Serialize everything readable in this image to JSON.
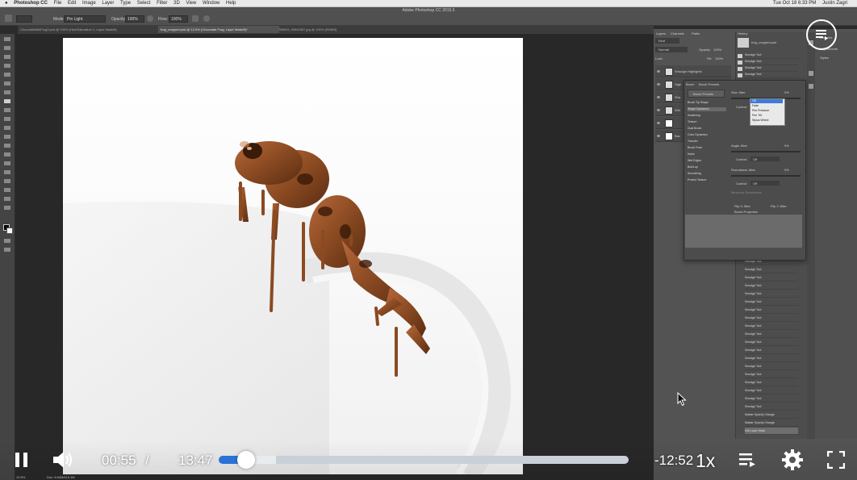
{
  "menubar": {
    "apple": "",
    "app_name": "Photoshop CC",
    "items": [
      "File",
      "Edit",
      "Image",
      "Layer",
      "Type",
      "Select",
      "Filter",
      "3D",
      "View",
      "Window",
      "Help"
    ],
    "clock": "Tue Oct 18 6:33 PM",
    "user": "Justin Zagri"
  },
  "window_title": "Adobe Photoshop CC 2015.5",
  "options_bar": {
    "mode_label": "Mode:",
    "mode_value": "Pin Light",
    "opacity_label": "Opacity:",
    "opacity_value": "100%",
    "flow_label": "Flow:",
    "flow_value": "100%"
  },
  "doc_tabs": [
    {
      "label": "ChocolateMilkFrog3.psd @ 100% (Hue/Saturation 1, Layer Mask/8)",
      "active": false
    },
    {
      "label": "frog_cropped.psd @ 12.5% (Chocolate Frog, Layer Mask/8)*",
      "active": true
    },
    {
      "label": "768615_93504357.jpg @ 100% (RGB/8)",
      "active": false
    }
  ],
  "panels": {
    "layers_tabs": [
      "Layers",
      "Channels",
      "Paths"
    ],
    "kind_label": "Kind",
    "blend_label": "Normal",
    "opacity_label": "Opacity:",
    "opacity_value": "100%",
    "lock_label": "Lock:",
    "fill_label": "Fill:",
    "fill_value": "100%",
    "layers": [
      {
        "name": "Smudge Highlights"
      },
      {
        "name": "High"
      },
      {
        "name": "Sha"
      },
      {
        "name": "Whi"
      },
      {
        "name": ""
      },
      {
        "name": "Bac"
      }
    ],
    "history_tab": "History",
    "history_snapshot": "frog_cropped.psd",
    "history_items": [
      "Smudge Tool",
      "Smudge Tool",
      "Smudge Tool",
      "Smudge Tool",
      "Smudge Tool",
      "Smudge Tool",
      "Smudge Tool",
      "Smudge Tool",
      "Smudge Tool",
      "Smudge Tool",
      "Smudge Tool",
      "Smudge Tool",
      "Smudge Tool",
      "Smudge Tool",
      "Smudge Tool",
      "Smudge Tool",
      "Smudge Tool",
      "Smudge Tool",
      "Smudge Tool",
      "Smudge Tool",
      "Smudge Tool",
      "Smudge Tool",
      "Smudge Tool",
      "Master Opacity Change",
      "Master Opacity Change",
      "Edit Layer Mask"
    ],
    "right_labels": [
      "Libraries",
      "Adjustments",
      "Styles"
    ]
  },
  "brush_panel": {
    "tabs": [
      "Brush",
      "Brush Presets"
    ],
    "presets_button": "Brush Presets",
    "tip_shape": "Brush Tip Shape",
    "options": [
      "Shape Dynamics",
      "Scattering",
      "Texture",
      "Dual Brush",
      "Color Dynamics",
      "Transfer",
      "Brush Pose",
      "Noise",
      "Wet Edges",
      "Build-up",
      "Smoothing",
      "Protect Texture"
    ],
    "size_jitter_label": "Size Jitter",
    "control_label": "Control:",
    "control_value": "Off",
    "angle_jitter_label": "Angle Jitter",
    "roundness_jitter_label": "Roundness Jitter",
    "minimum_roundness_label": "Minimum Roundness",
    "flip_x": "Flip X Jitter",
    "flip_y": "Flip Y Jitter",
    "projection": "Brush Projection",
    "percent_zero": "0%"
  },
  "dropdown_options": [
    "Off",
    "Fade",
    "Pen Pressure",
    "Pen Tilt",
    "Stylus Wheel"
  ],
  "status_bar": {
    "zoom": "12.5%",
    "doc_size": "Doc: 6.64M/113.1M"
  },
  "video": {
    "current_time": "00:55",
    "separator": "/",
    "duration": "13:47",
    "remaining": "-12:52",
    "speed": "1x",
    "progress_fraction": 0.0665,
    "buffered_fraction": 0.14
  }
}
